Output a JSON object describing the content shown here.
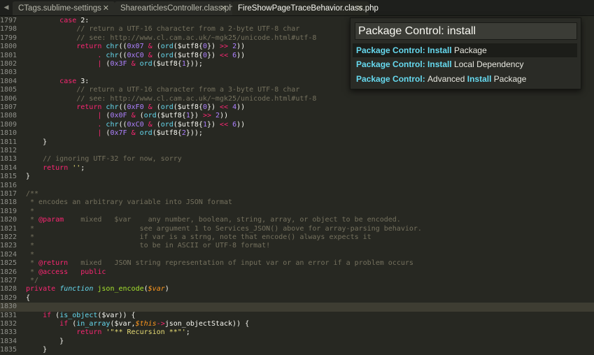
{
  "tabs": [
    {
      "label": "CTags.sublime-settings",
      "close": "✕"
    },
    {
      "label": "SharearticlesController.class.php",
      "close": "✕"
    },
    {
      "label": "FireShowPageTraceBehavior.class.php",
      "close": "✕",
      "active": true
    }
  ],
  "tab_nav_icon": "◀",
  "palette": {
    "query": "Package Control: install",
    "items": [
      {
        "parts": [
          {
            "t": "Package Control: ",
            "m": true
          },
          {
            "t": "Install",
            "m": true
          },
          {
            "t": " Package",
            "m": false
          }
        ],
        "selected": true
      },
      {
        "parts": [
          {
            "t": "Package Control: ",
            "m": true
          },
          {
            "t": "Install",
            "m": true
          },
          {
            "t": " Local Dependency",
            "m": false
          }
        ],
        "selected": false
      },
      {
        "parts": [
          {
            "t": "Package Control: ",
            "m": true
          },
          {
            "t": "Advanced ",
            "m": false
          },
          {
            "t": "Install",
            "m": true
          },
          {
            "t": " Package",
            "m": false
          }
        ],
        "selected": false
      }
    ]
  },
  "current_line": "1830",
  "lines": [
    {
      "n": "1797",
      "t": [
        [
          "        ",
          ""
        ],
        [
          "case",
          "k"
        ],
        [
          " 2:",
          ""
        ]
      ]
    },
    {
      "n": "1798",
      "t": [
        [
          "            // return a UTF-16 character from a 2-byte UTF-8 char",
          "c"
        ]
      ]
    },
    {
      "n": "1799",
      "t": [
        [
          "            // see: http://www.cl.cam.ac.uk/~mgk25/unicode.html#utf-8",
          "c"
        ]
      ]
    },
    {
      "n": "1800",
      "t": [
        [
          "            ",
          ""
        ],
        [
          "return",
          "k"
        ],
        [
          " ",
          ""
        ],
        [
          "chr",
          "f"
        ],
        [
          "((",
          ""
        ],
        [
          "0x07",
          "n"
        ],
        [
          " ",
          ""
        ],
        [
          "&",
          "k"
        ],
        [
          " (",
          ""
        ],
        [
          "ord",
          "f"
        ],
        [
          "($utf8{",
          ""
        ],
        [
          "0",
          "n"
        ],
        [
          "}) ",
          ""
        ],
        [
          ">>",
          "k"
        ],
        [
          " ",
          ""
        ],
        [
          "2",
          "n"
        ],
        [
          "))",
          ""
        ]
      ]
    },
    {
      "n": "1801",
      "t": [
        [
          "                 ",
          ""
        ],
        [
          ".",
          "k"
        ],
        [
          " ",
          ""
        ],
        [
          "chr",
          "f"
        ],
        [
          "((",
          ""
        ],
        [
          "0xC0",
          "n"
        ],
        [
          " ",
          ""
        ],
        [
          "&",
          "k"
        ],
        [
          " (",
          ""
        ],
        [
          "ord",
          "f"
        ],
        [
          "($utf8{",
          ""
        ],
        [
          "0",
          "n"
        ],
        [
          "}) ",
          ""
        ],
        [
          "<<",
          "k"
        ],
        [
          " ",
          ""
        ],
        [
          "6",
          "n"
        ],
        [
          "))",
          ""
        ]
      ]
    },
    {
      "n": "1802",
      "t": [
        [
          "                 ",
          ""
        ],
        [
          "|",
          "k"
        ],
        [
          " (",
          ""
        ],
        [
          "0x3F",
          "n"
        ],
        [
          " ",
          ""
        ],
        [
          "&",
          "k"
        ],
        [
          " ",
          ""
        ],
        [
          "ord",
          "f"
        ],
        [
          "($utf8{",
          ""
        ],
        [
          "1",
          "n"
        ],
        [
          "}));",
          ""
        ]
      ]
    },
    {
      "n": "1803",
      "t": []
    },
    {
      "n": "1804",
      "t": [
        [
          "        ",
          ""
        ],
        [
          "case",
          "k"
        ],
        [
          " 3:",
          ""
        ]
      ]
    },
    {
      "n": "1805",
      "t": [
        [
          "            // return a UTF-16 character from a 3-byte UTF-8 char",
          "c"
        ]
      ]
    },
    {
      "n": "1806",
      "t": [
        [
          "            // see: http://www.cl.cam.ac.uk/~mgk25/unicode.html#utf-8",
          "c"
        ]
      ]
    },
    {
      "n": "1807",
      "t": [
        [
          "            ",
          ""
        ],
        [
          "return",
          "k"
        ],
        [
          " ",
          ""
        ],
        [
          "chr",
          "f"
        ],
        [
          "((",
          ""
        ],
        [
          "0xF0",
          "n"
        ],
        [
          " ",
          ""
        ],
        [
          "&",
          "k"
        ],
        [
          " (",
          ""
        ],
        [
          "ord",
          "f"
        ],
        [
          "($utf8{",
          ""
        ],
        [
          "0",
          "n"
        ],
        [
          "}) ",
          ""
        ],
        [
          "<<",
          "k"
        ],
        [
          " ",
          ""
        ],
        [
          "4",
          "n"
        ],
        [
          "))",
          ""
        ]
      ]
    },
    {
      "n": "1808",
      "t": [
        [
          "                 ",
          ""
        ],
        [
          "|",
          "k"
        ],
        [
          " (",
          ""
        ],
        [
          "0x0F",
          "n"
        ],
        [
          " ",
          ""
        ],
        [
          "&",
          "k"
        ],
        [
          " (",
          ""
        ],
        [
          "ord",
          "f"
        ],
        [
          "($utf8{",
          ""
        ],
        [
          "1",
          "n"
        ],
        [
          "}) ",
          ""
        ],
        [
          ">>",
          "k"
        ],
        [
          " ",
          ""
        ],
        [
          "2",
          "n"
        ],
        [
          "))",
          ""
        ]
      ]
    },
    {
      "n": "1809",
      "t": [
        [
          "                 ",
          ""
        ],
        [
          ".",
          "k"
        ],
        [
          " ",
          ""
        ],
        [
          "chr",
          "f"
        ],
        [
          "((",
          ""
        ],
        [
          "0xC0",
          "n"
        ],
        [
          " ",
          ""
        ],
        [
          "&",
          "k"
        ],
        [
          " (",
          ""
        ],
        [
          "ord",
          "f"
        ],
        [
          "($utf8{",
          ""
        ],
        [
          "1",
          "n"
        ],
        [
          "}) ",
          ""
        ],
        [
          "<<",
          "k"
        ],
        [
          " ",
          ""
        ],
        [
          "6",
          "n"
        ],
        [
          "))",
          ""
        ]
      ]
    },
    {
      "n": "1810",
      "t": [
        [
          "                 ",
          ""
        ],
        [
          "|",
          "k"
        ],
        [
          " (",
          ""
        ],
        [
          "0x7F",
          "n"
        ],
        [
          " ",
          ""
        ],
        [
          "&",
          "k"
        ],
        [
          " ",
          ""
        ],
        [
          "ord",
          "f"
        ],
        [
          "($utf8{",
          ""
        ],
        [
          "2",
          "n"
        ],
        [
          "}));",
          ""
        ]
      ]
    },
    {
      "n": "1811",
      "t": [
        [
          "    }",
          ""
        ]
      ]
    },
    {
      "n": "1812",
      "t": []
    },
    {
      "n": "1813",
      "t": [
        [
          "    // ignoring UTF-32 for now, sorry",
          "c"
        ]
      ]
    },
    {
      "n": "1814",
      "t": [
        [
          "    ",
          ""
        ],
        [
          "return",
          "k"
        ],
        [
          " ",
          ""
        ],
        [
          "''",
          "s"
        ],
        [
          ";",
          ""
        ]
      ]
    },
    {
      "n": "1815",
      "t": [
        [
          "}",
          ""
        ]
      ]
    },
    {
      "n": "1816",
      "t": []
    },
    {
      "n": "1817",
      "t": [
        [
          "/**",
          "c"
        ]
      ]
    },
    {
      "n": "1818",
      "t": [
        [
          " * encodes an arbitrary variable into JSON format",
          "c"
        ]
      ]
    },
    {
      "n": "1819",
      "t": [
        [
          " *",
          "c"
        ]
      ]
    },
    {
      "n": "1820",
      "t": [
        [
          " * ",
          "c"
        ],
        [
          "@param",
          "k"
        ],
        [
          "    mixed   $var    any number, boolean, string, array, or object to be encoded.",
          "c"
        ]
      ]
    },
    {
      "n": "1821",
      "t": [
        [
          " *                         see argument 1 to Services_JSON() above for array-parsing behavior.",
          "c"
        ]
      ]
    },
    {
      "n": "1822",
      "t": [
        [
          " *                         if var is a strng, note that encode() always expects it",
          "c"
        ]
      ]
    },
    {
      "n": "1823",
      "t": [
        [
          " *                         to be in ASCII or UTF-8 format!",
          "c"
        ]
      ]
    },
    {
      "n": "1824",
      "t": [
        [
          " *",
          "c"
        ]
      ]
    },
    {
      "n": "1825",
      "t": [
        [
          " * ",
          "c"
        ],
        [
          "@return",
          "k"
        ],
        [
          "   mixed   JSON string representation of input var or an error if a problem occurs",
          "c"
        ]
      ]
    },
    {
      "n": "1826",
      "t": [
        [
          " * ",
          "c"
        ],
        [
          "@access",
          "k"
        ],
        [
          "   ",
          "c"
        ],
        [
          "public",
          "k"
        ]
      ]
    },
    {
      "n": "1827",
      "t": [
        [
          " */",
          "c"
        ]
      ]
    },
    {
      "n": "1828",
      "t": [
        [
          "",
          ""
        ],
        [
          "private",
          "k"
        ],
        [
          " ",
          ""
        ],
        [
          "function",
          "fi"
        ],
        [
          " ",
          ""
        ],
        [
          "json_encode",
          "g"
        ],
        [
          "(",
          ""
        ],
        [
          "$var",
          "v"
        ],
        [
          ")",
          ""
        ]
      ]
    },
    {
      "n": "1829",
      "t": [
        [
          "{",
          ""
        ]
      ]
    },
    {
      "n": "1830",
      "t": []
    },
    {
      "n": "1831",
      "t": [
        [
          "    ",
          ""
        ],
        [
          "if",
          "k"
        ],
        [
          " (",
          ""
        ],
        [
          "is_object",
          "f"
        ],
        [
          "($var)) {",
          ""
        ]
      ]
    },
    {
      "n": "1832",
      "t": [
        [
          "        ",
          ""
        ],
        [
          "if",
          "k"
        ],
        [
          " (",
          ""
        ],
        [
          "in_array",
          "f"
        ],
        [
          "($var,",
          ""
        ],
        [
          "$this",
          "v"
        ],
        [
          "->",
          "k"
        ],
        [
          "json_objectStack)) {",
          ""
        ]
      ]
    },
    {
      "n": "1833",
      "t": [
        [
          "            ",
          ""
        ],
        [
          "return",
          "k"
        ],
        [
          " ",
          ""
        ],
        [
          "'\"** Recursion **\"'",
          "s"
        ],
        [
          ";",
          ""
        ]
      ]
    },
    {
      "n": "1834",
      "t": [
        [
          "        }",
          ""
        ]
      ]
    },
    {
      "n": "1835",
      "t": [
        [
          "    }",
          ""
        ]
      ]
    }
  ]
}
